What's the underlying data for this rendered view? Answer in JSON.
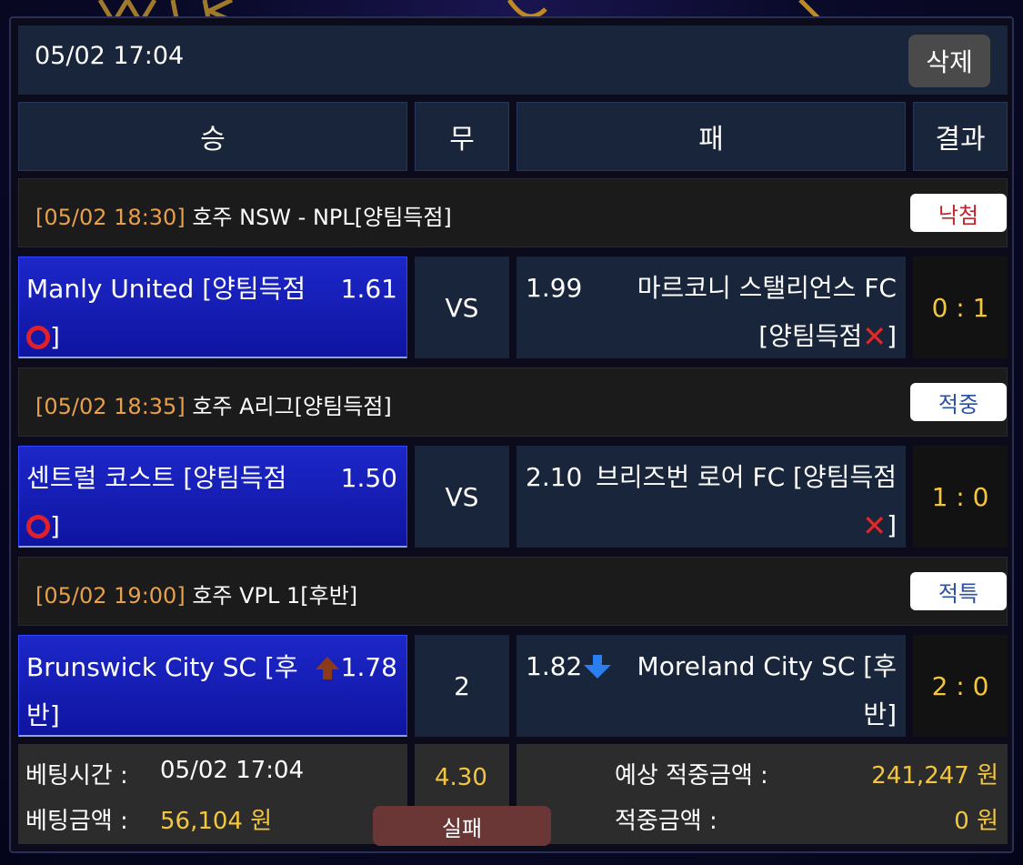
{
  "header": {
    "datetime": "05/02 17:04",
    "delete_label": "삭제"
  },
  "columns": {
    "win": "승",
    "draw": "무",
    "lose": "패",
    "result": "결과"
  },
  "matches": [
    {
      "time": "[05/02 18:30]",
      "league": "호주 NSW - NPL[양팀득점]",
      "status": "낙첨",
      "status_color": "#c0272d",
      "home_name": "Manly United [양팀득점",
      "home_tail": "]",
      "home_odds": "1.61",
      "middle": "VS",
      "away_odds": "1.99",
      "away_name": "마르코니 스탤리언스 FC [양팀득점",
      "away_tail": "]",
      "score": "0 : 1"
    },
    {
      "time": "[05/02 18:35]",
      "league": "호주 A리그[양팀득점]",
      "status": "적중",
      "status_color": "#2a4fa8",
      "home_name": "센트럴 코스트 [양팀득점",
      "home_tail": "]",
      "home_odds": "1.50",
      "middle": "VS",
      "away_odds": "2.10",
      "away_name": "브리즈번 로어 FC [양팀득점",
      "away_tail": "]",
      "score": "1 : 0"
    },
    {
      "time": "[05/02 19:00]",
      "league": "호주 VPL 1[후반]",
      "status": "적특",
      "status_color": "#2a4fa8",
      "home_name": "Brunswick City SC [후반]",
      "home_odds": "1.78",
      "middle": "2",
      "away_odds": "1.82",
      "away_name": "Moreland City SC [후반]",
      "score": "2 : 0"
    }
  ],
  "footer": {
    "bet_time_label": "베팅시간 :",
    "bet_time_value": "05/02 17:04",
    "bet_amount_label": "베팅금액 :",
    "bet_amount_value": "56,104 원",
    "total_odds": "4.30",
    "outcome": "실패",
    "expected_label": "예상 적중금액 :",
    "expected_value": "241,247 원",
    "win_label": "적중금액 :",
    "win_value": "0 원"
  },
  "colors": {
    "home_bg": "#1c27c8",
    "cell_bg": "#18253a",
    "score": "#f3c640",
    "time": "#e7a04c"
  },
  "icons": {
    "home_pick": "red-circle-icon",
    "away_pick": "red-x-icon",
    "up": "up-arrow-icon",
    "down": "down-arrow-icon"
  }
}
